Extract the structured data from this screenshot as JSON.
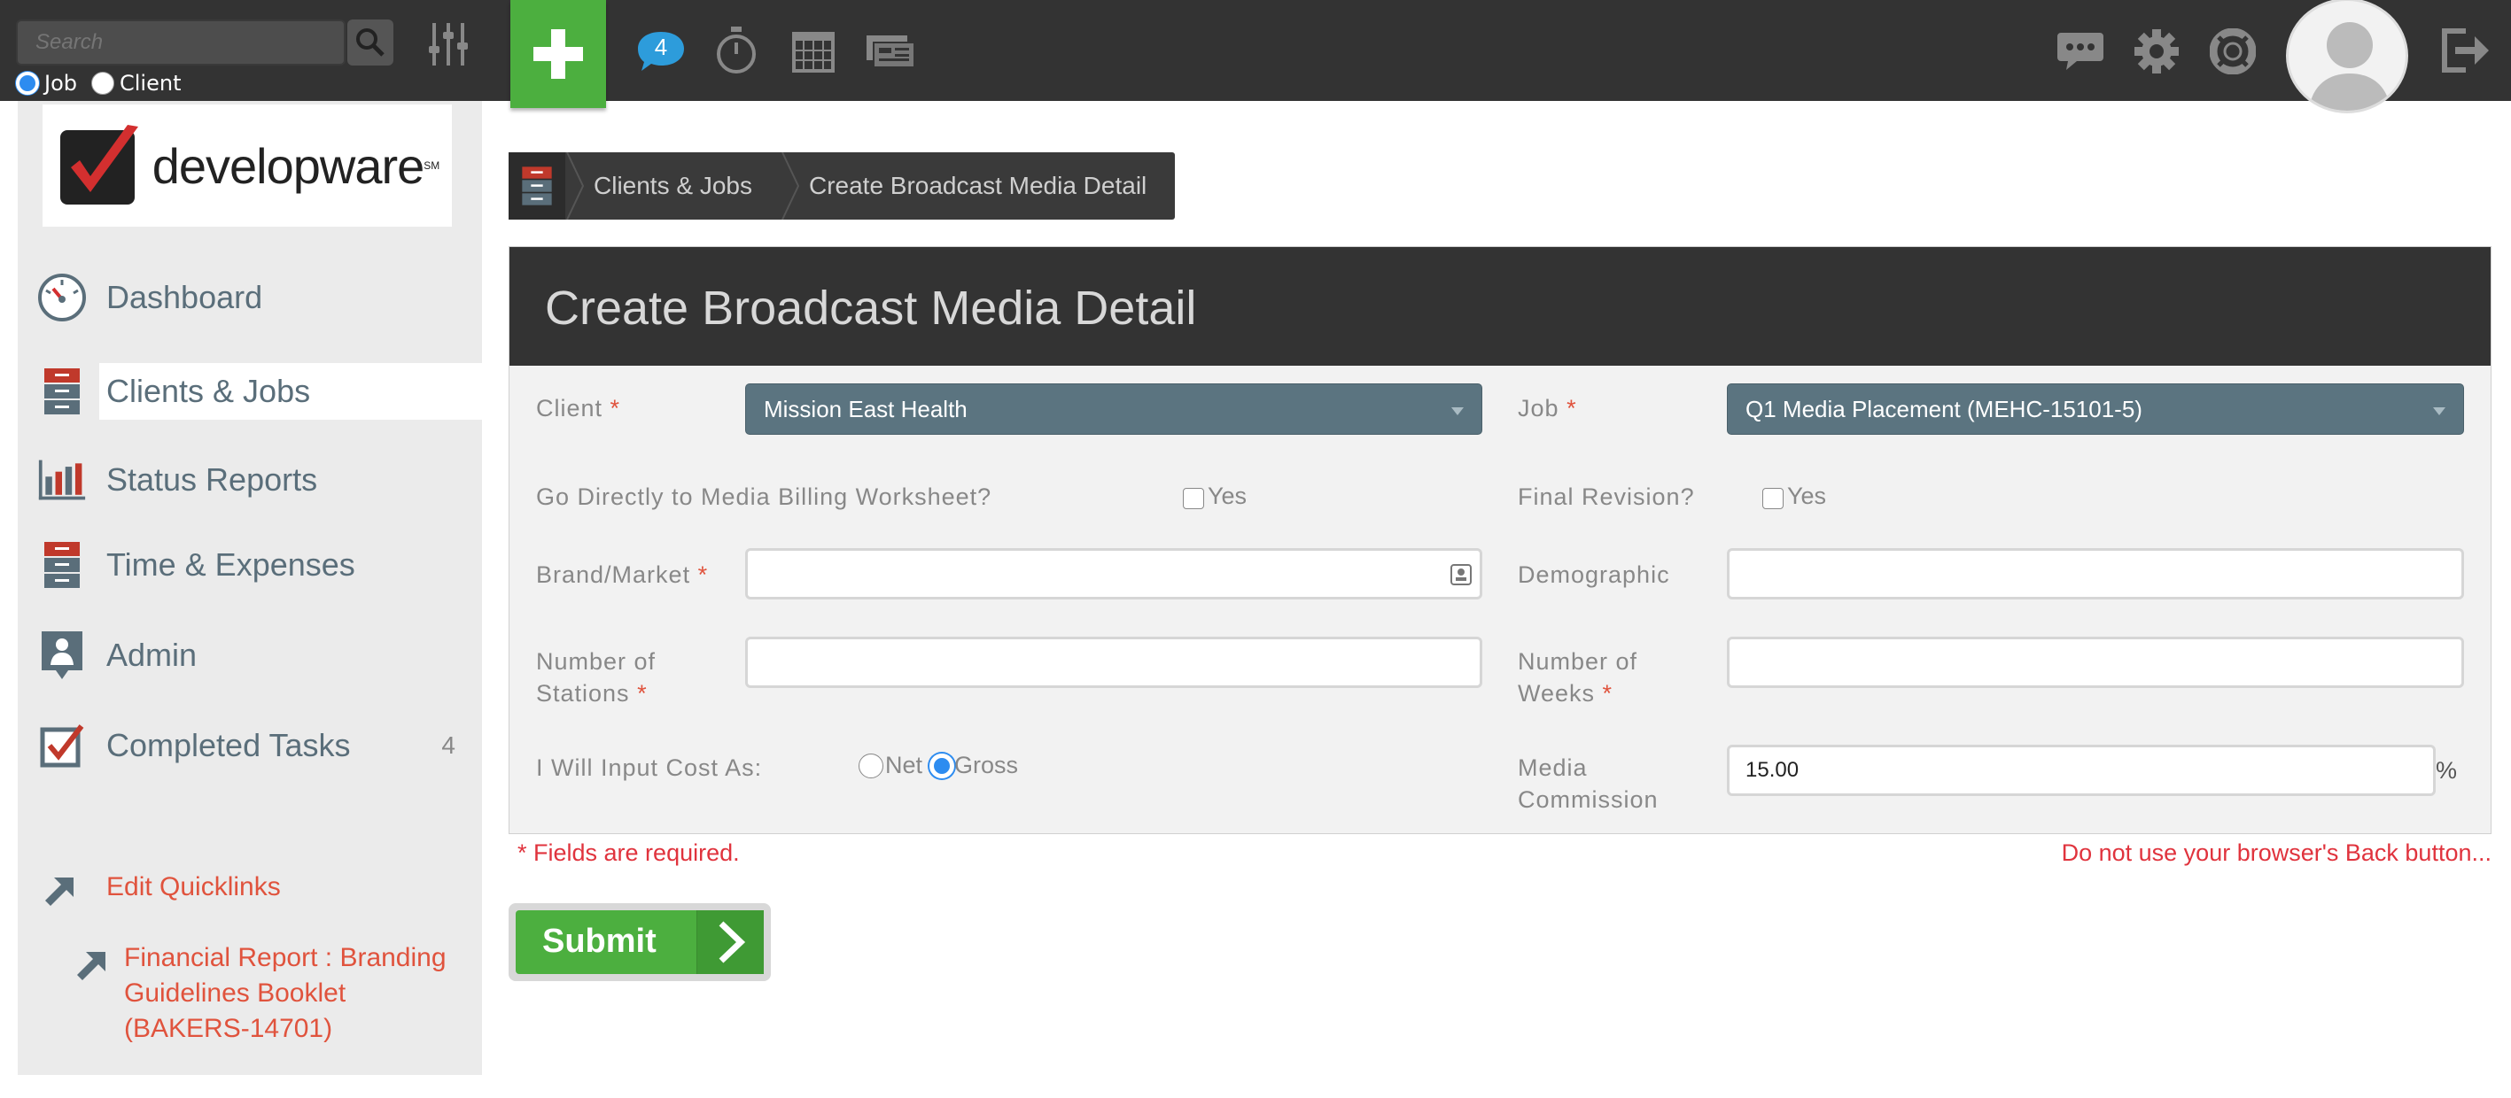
{
  "topbar": {
    "search_placeholder": "Search",
    "radio_job": "Job",
    "radio_client": "Client",
    "selected_radio": "Job",
    "notifications_count": "4",
    "accent_green": "#4caf3f",
    "badge_blue": "#2d9cdb"
  },
  "sidebar": {
    "logo_text": "developware",
    "logo_mark": "SM",
    "items": [
      {
        "label": "Dashboard",
        "icon": "dashboard-gauge-icon"
      },
      {
        "label": "Clients & Jobs",
        "icon": "file-cabinet-icon",
        "active": true
      },
      {
        "label": "Status Reports",
        "icon": "bar-chart-icon"
      },
      {
        "label": "Time & Expenses",
        "icon": "file-cabinet-icon"
      },
      {
        "label": "Admin",
        "icon": "admin-badge-icon"
      },
      {
        "label": "Completed Tasks",
        "icon": "checkbox-icon",
        "count": "4"
      }
    ],
    "edit_quicklinks": "Edit Quicklinks",
    "quicklinks": [
      {
        "label": "Financial Report : Branding Guidelines Booklet (BAKERS-14701)"
      }
    ],
    "quicklink_lines": [
      "Financial Report : Branding",
      "Guidelines Booklet",
      "(BAKERS-14701)"
    ]
  },
  "breadcrumb": {
    "items": [
      "Clients & Jobs",
      "Create Broadcast Media Detail"
    ]
  },
  "form": {
    "title": "Create Broadcast Media Detail",
    "client_label": "Client",
    "client_value": "Mission East Health",
    "job_label": "Job",
    "job_value": "Q1 Media Placement (MEHC-15101-5)",
    "go_directly_label": "Go Directly to Media Billing Worksheet?",
    "go_directly_option": "Yes",
    "final_revision_label": "Final Revision?",
    "final_revision_option": "Yes",
    "brand_market_label": "Brand/Market",
    "brand_market_value": "",
    "demographic_label": "Demographic",
    "demographic_value": "",
    "num_stations_label_1": "Number of",
    "num_stations_label_2": "Stations",
    "num_stations_value": "",
    "num_weeks_label_1": "Number of",
    "num_weeks_label_2": "Weeks",
    "num_weeks_value": "",
    "cost_label": "I Will Input Cost As:",
    "cost_net": "Net",
    "cost_gross": "Gross",
    "cost_selected": "Gross",
    "media_commission_label_1": "Media",
    "media_commission_label_2": "Commission",
    "media_commission_value": "15.00",
    "percent_sign": "%",
    "required_marker": "*",
    "required_note": "* Fields are required.",
    "back_warning": "Do not use your browser's Back button...",
    "submit_label": "Submit"
  }
}
